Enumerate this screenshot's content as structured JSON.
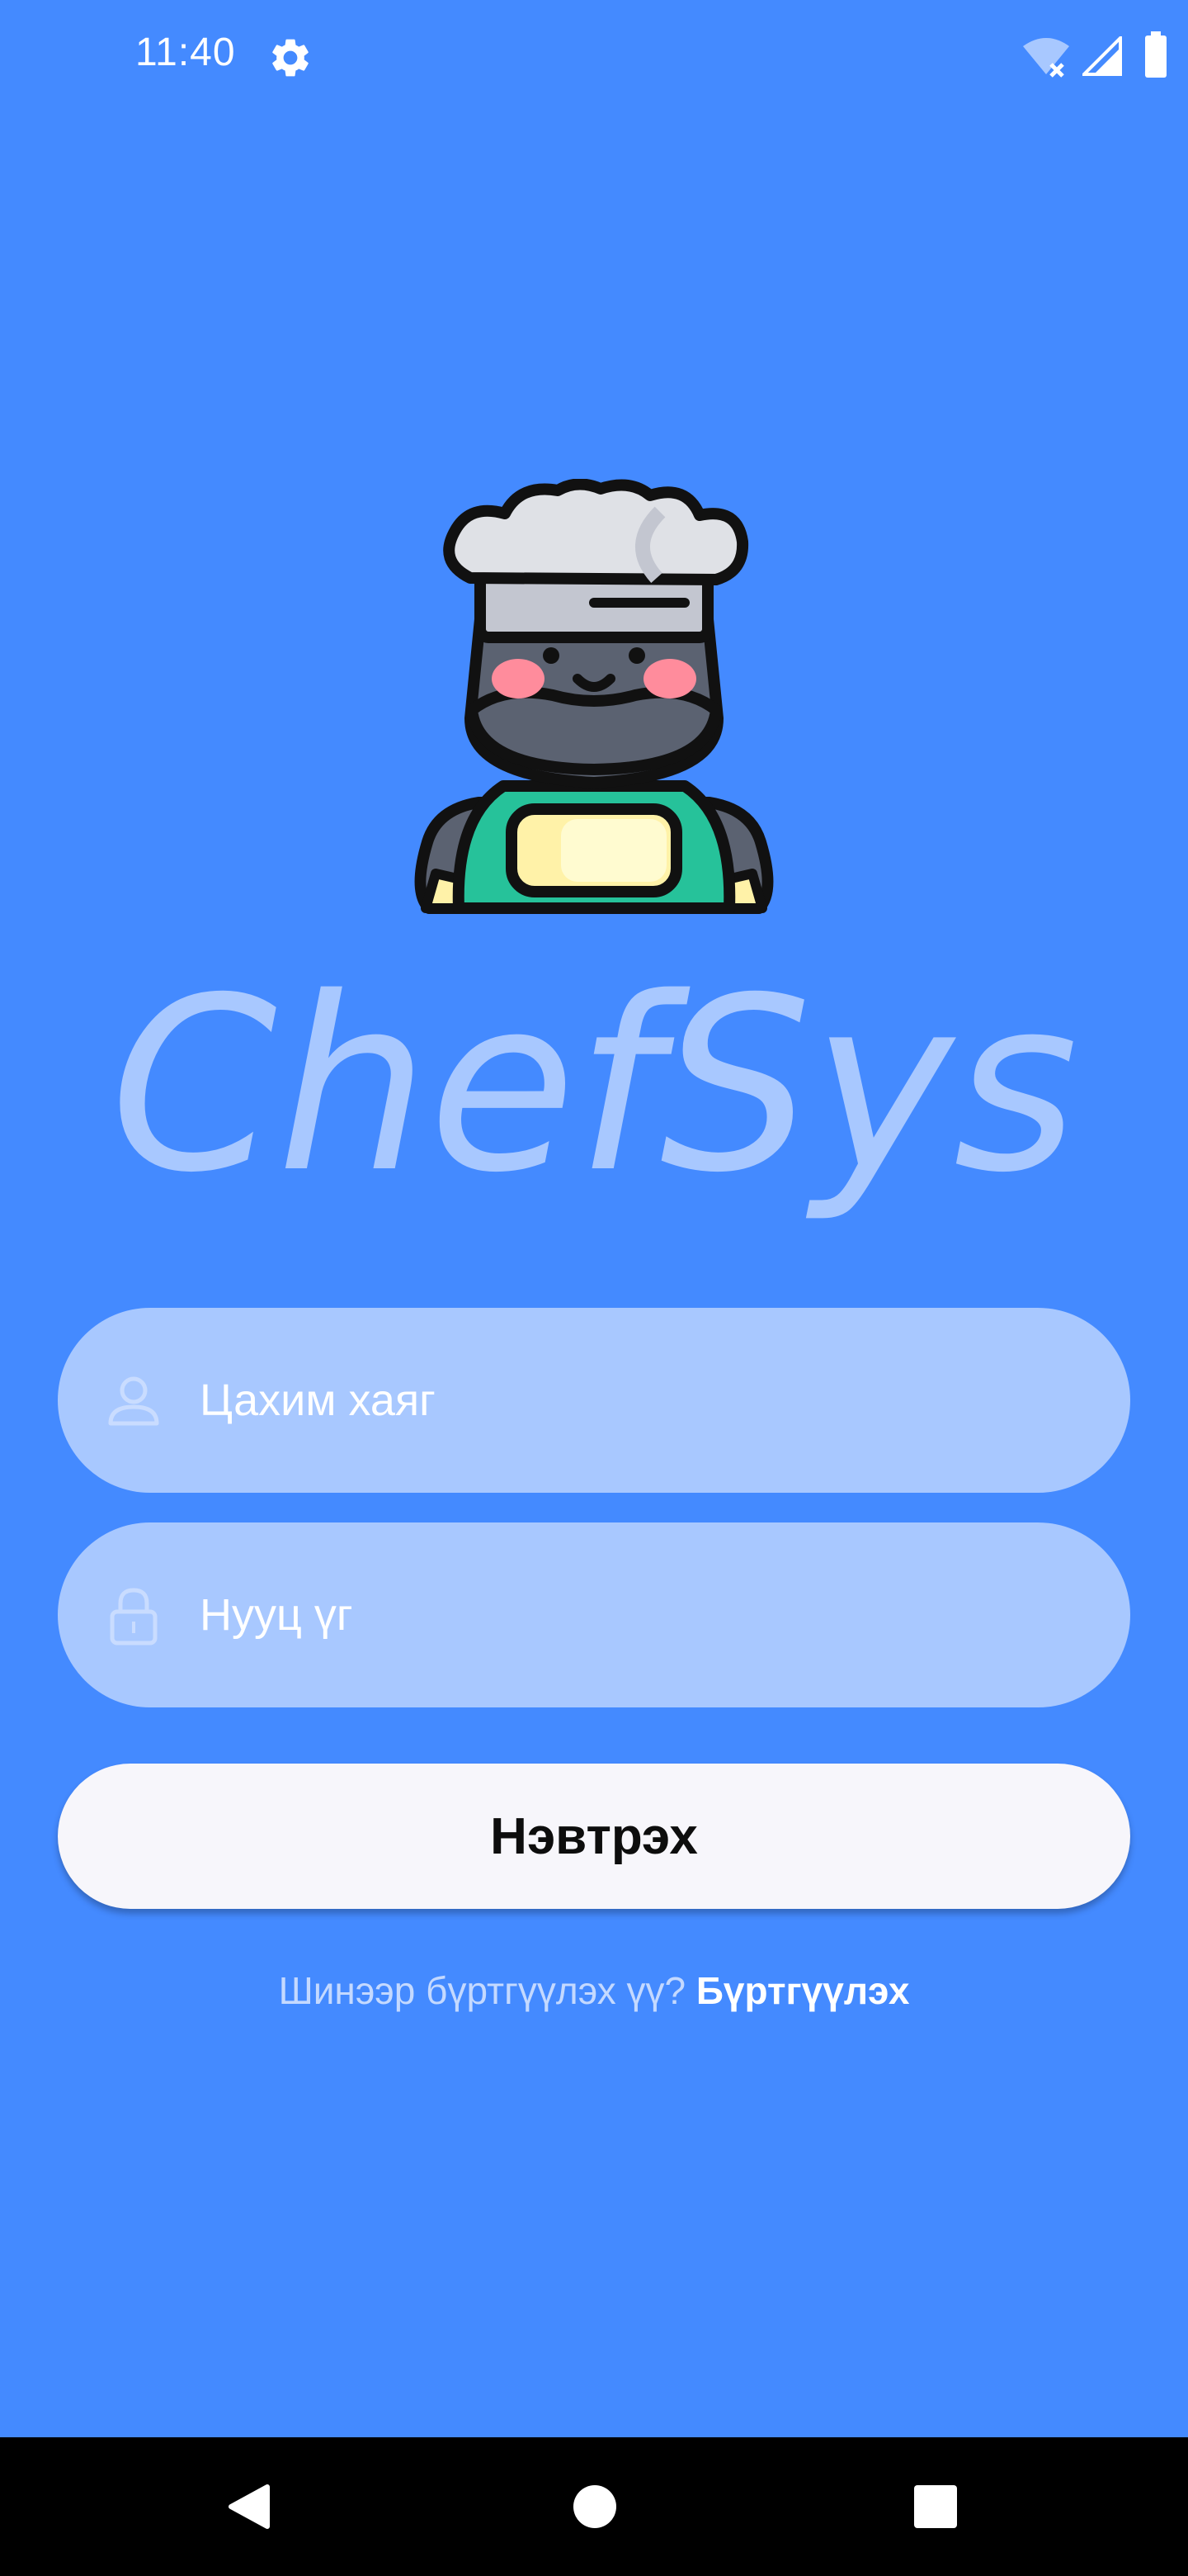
{
  "status_bar": {
    "time": "11:40",
    "icons": [
      "settings-gear-icon",
      "wifi-off-icon",
      "cell-signal-icon",
      "battery-icon"
    ]
  },
  "logo": {
    "icon": "chef-mascot-icon"
  },
  "brand": {
    "name": "ChefSys",
    "color": "#a8c8ff"
  },
  "form": {
    "email": {
      "placeholder": "Цахим хаяг",
      "value": "",
      "icon": "person-icon"
    },
    "password": {
      "placeholder": "Нууц үг",
      "value": "",
      "icon": "lock-icon"
    },
    "login_label": "Нэвтрэх"
  },
  "signup": {
    "prompt": "Шинээр бүртгүүлэх үү?",
    "link": "Бүртгүүлэх"
  },
  "nav": {
    "icons": [
      "back-icon",
      "home-icon",
      "recents-icon"
    ]
  },
  "colors": {
    "background": "#448aff",
    "field": "#a8c8ff",
    "button": "#f7f6fb"
  }
}
